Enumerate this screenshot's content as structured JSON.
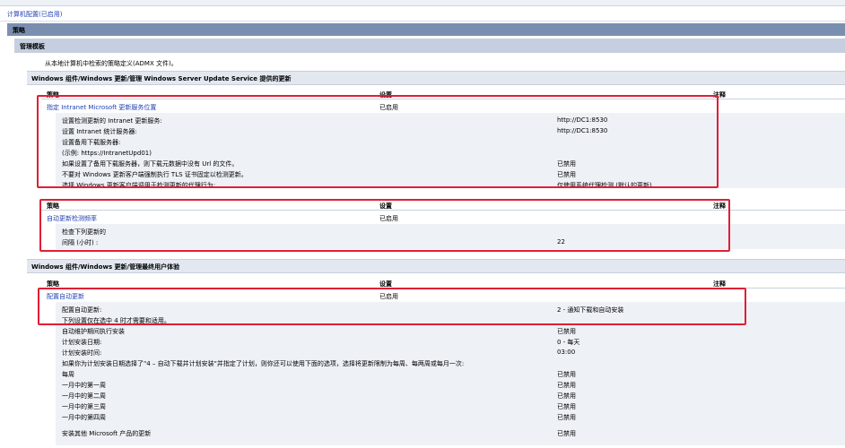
{
  "header": {
    "computer_config": "计算机配置(已启用)",
    "policies": "策略",
    "admin_templates": "管理模板",
    "admx_note": "从本地计算机中检索的策略定义(ADMX 文件)。"
  },
  "sections": {
    "wsus_title": "Windows 组件/Windows 更新/管理 Windows Server Update Service 提供的更新",
    "enduser_title": "Windows 组件/Windows 更新/管理最终用户体验"
  },
  "columns": {
    "policy": "策略",
    "setting": "设置",
    "comment": "注释"
  },
  "block1": {
    "policy": "指定 Intranet Microsoft 更新服务位置",
    "state": "已启用",
    "rows": [
      {
        "label": "设置检测更新的 Intranet 更新服务:",
        "value": "http://DC1:8530"
      },
      {
        "label": "设置 Intranet 统计服务器:",
        "value": "http://DC1:8530"
      },
      {
        "label": "设置备用下载服务器:",
        "value": ""
      },
      {
        "label": "(示例:   https://IntranetUpd01)",
        "value": ""
      },
      {
        "label": "如果设置了备用下载服务器，则下载元数据中没有 Url 的文件。",
        "value": "已禁用"
      },
      {
        "label": "不要对 Windows 更新客户端强制执行 TLS 证书固定以检测更新。",
        "value": "已禁用"
      },
      {
        "label": "选择 Windows 更新客户端调用于检测更新的代理行为:",
        "value": "仅使用系统代理检测 (默认的更新)"
      }
    ]
  },
  "block2": {
    "policy": "自动更新检测频率",
    "state": "已启用",
    "rows": [
      {
        "label": "检查下列更新的",
        "value": ""
      },
      {
        "label": "间隔 (小时) :",
        "value": "22"
      }
    ]
  },
  "block3": {
    "policy": "配置自动更新",
    "state": "已启用",
    "rows": [
      {
        "label": "配置自动更新:",
        "value": "2 - 通知下载和自动安装"
      },
      {
        "label": "下列设置仅在选中 4 时才需要和适用。",
        "value": ""
      },
      {
        "label": "自动维护期间执行安装",
        "value": "已禁用"
      },
      {
        "label": "计划安装日期:",
        "value": "0 - 每天"
      },
      {
        "label": "计划安装时间:",
        "value": "03:00"
      },
      {
        "label": "如果你为计划安装日期选择了\"4 – 自动下载并计划安装\"并指定了计划，则你还可以使用下面的选项，选择将更新限制为每周、每两周或每月一次:",
        "value": ""
      },
      {
        "label": "每周",
        "value": "已禁用"
      },
      {
        "label": "一月中的第一周",
        "value": "已禁用"
      },
      {
        "label": "一月中的第二周",
        "value": "已禁用"
      },
      {
        "label": "一月中的第三周",
        "value": "已禁用"
      },
      {
        "label": "一月中的第四周",
        "value": "已禁用"
      },
      {
        "label": "",
        "value": ""
      },
      {
        "label": "安装其他 Microsoft 产品的更新",
        "value": "已禁用"
      }
    ]
  }
}
